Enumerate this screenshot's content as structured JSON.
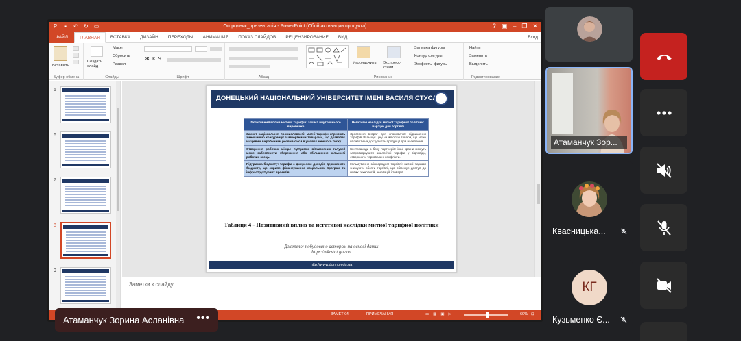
{
  "powerpoint": {
    "window_title": "Огородник_презентація - PowerPoint (Сбой активации продукта)",
    "tabs": [
      "ФАЙЛ",
      "ГЛАВНАЯ",
      "ВСТАВКА",
      "ДИЗАЙН",
      "ПЕРЕХОДЫ",
      "АНИМАЦИЯ",
      "ПОКАЗ СЛАЙДОВ",
      "РЕЦЕНЗИРОВАНИЕ",
      "ВИД"
    ],
    "login_label": "Вход",
    "ribbon": {
      "paste": "Вставить",
      "create_slide": "Создать слайд",
      "layout": "Макет",
      "reset": "Сбросить",
      "section": "Раздел",
      "arrange": "Упорядочить",
      "quick_styles": "Экспресс-стили",
      "shape_fill": "Заливка фигуры",
      "shape_outline": "Контур фигуры",
      "shape_effects": "Эффекты фигуры",
      "find": "Найти",
      "replace": "Заменить",
      "select": "Выделить",
      "groups": {
        "clipboard": "Буфер обмена",
        "slides": "Слайды",
        "font": "Шрифт",
        "paragraph": "Абзац",
        "drawing": "Рисование",
        "editing": "Редактирование"
      }
    },
    "thumbnails": [
      "5",
      "6",
      "7",
      "8",
      "9"
    ],
    "selected_slide": "8",
    "slide": {
      "header": "ДОНЕЦЬКИЙ НАЦІОНАЛЬНИЙ УНІВЕРСИТЕТ ІМЕНІ ВАСИЛЯ СТУСА",
      "table": {
        "headers": [
          "Позитивний вплив митних тарифів: захист внутрішнього виробника",
          "Негативні наслідки митної тарифної політики: бар'єри для торгівлі"
        ],
        "rows": [
          [
            "Захист національної промисловості: митні тарифи сприяють зменшенню конкуренції з імпортними товарами, що дозволяє місцевим виробникам розвиватися в умовах меншого тиску.",
            "Зростання витрат для споживачів: підвищення тарифів збільшує ціну на імпортні товари, що може впливати на доступність продукції для населення"
          ],
          [
            "Створення робочих місць: підтримка вітчизняних галузей може забезпечити збереження або збільшення кількості робочих місць.",
            "Контрзаходи з боку партнерів: інші країни можуть запроваджувати аналогічні тарифи у відповідь, створюючи торговельні конфлікти."
          ],
          [
            "Підтримка бюджету: тарифи є джерелом доходів державного бюджету, що сприяє фінансуванню соціальних програм та інфраструктурних проектів.",
            "Гальмування міжнародної торгівлі: високі тарифи знижують обсяги торгівлі, що обмежує доступ до нових технологій, інновацій і товарів."
          ]
        ]
      },
      "caption": "Таблиця 4 - Позитивний вплив та негативні наслідки митної тарифної політики",
      "source_line1": "Джерело: побудовано автором на основі даних",
      "source_line2": "https://ukrstat.gov.ua",
      "footer": "http://www.donnu.edu.ua"
    },
    "notes_placeholder": "Заметки к слайду",
    "status": {
      "notes": "ЗАМЕТКИ",
      "comments": "ПРИМЕЧАНИЯ",
      "zoom": "60%"
    }
  },
  "meeting": {
    "presenter_name": "Атаманчук Зорина Асланівна",
    "more_label": "•••",
    "participants": [
      {
        "name": "Атаманчук Зор..."
      },
      {
        "name": "Квасницька..."
      },
      {
        "name": "Кузьменко Є...",
        "initials": "КГ"
      }
    ],
    "colors": {
      "leave": "#c5221f",
      "active_border": "#8ab4f8",
      "powerpoint": "#d24726"
    }
  }
}
